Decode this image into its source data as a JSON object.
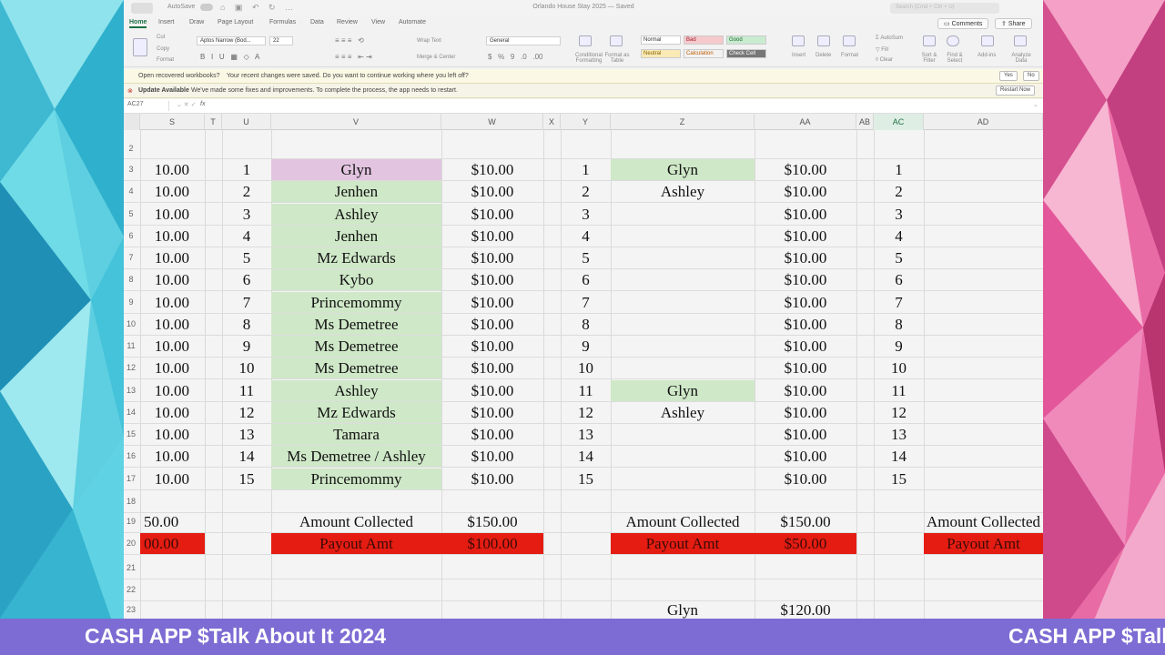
{
  "titlebar": {
    "title": "Orlando House Stay 2025 — Saved",
    "autosave": "AutoSave",
    "search_placeholder": "Search (Cmd + Ctrl + U)"
  },
  "tabs": [
    "Home",
    "Insert",
    "Draw",
    "Page Layout",
    "Formulas",
    "Data",
    "Review",
    "View",
    "Automate"
  ],
  "buttons": {
    "comments": "Comments",
    "share": "Share"
  },
  "ribbon": {
    "cut": "Cut",
    "copy": "Copy",
    "format": "Format",
    "font_name": "Aptos Narrow (Bod...",
    "font_size": "22",
    "wrap_text": "Wrap Text",
    "merge_center": "Merge & Center",
    "number_format": "General",
    "cond_format": "Conditional Formatting",
    "format_table": "Format as Table",
    "styles": [
      "Normal",
      "Bad",
      "Good",
      "Neutral",
      "Calculation",
      "Check Cell"
    ],
    "insert": "Insert",
    "delete": "Delete",
    "format_cells": "Format",
    "autosum": "AutoSum",
    "fill": "Fill",
    "clear": "Clear",
    "sort_filter": "Sort & Filter",
    "find_select": "Find & Select",
    "addins": "Add-ins",
    "analyze": "Analyze Data"
  },
  "messages": {
    "recovered": {
      "title": "Open recovered workbooks?",
      "body": "Your recent changes were saved. Do you want to continue working where you left off?",
      "yes": "Yes",
      "no": "No"
    },
    "update": {
      "title": "Update Available",
      "body": "We've made some fixes and improvements. To complete the process, the app needs to restart.",
      "restart": "Restart Now"
    }
  },
  "formula_bar": {
    "name_box": "AC27",
    "fx": "fx"
  },
  "columns": [
    "S",
    "T",
    "U",
    "V",
    "W",
    "X",
    "Y",
    "Z",
    "AA",
    "AB",
    "AC",
    "AD"
  ],
  "rows": [
    {
      "n": "2"
    },
    {
      "n": "3",
      "s": "10.00",
      "u": "1",
      "v": "Glyn",
      "w": "$10.00",
      "y": "1",
      "z": "Glyn",
      "aa": "$10.00",
      "ac": "1"
    },
    {
      "n": "4",
      "s": "10.00",
      "u": "2",
      "v": "Jenhen",
      "w": "$10.00",
      "y": "2",
      "z": "Ashley",
      "aa": "$10.00",
      "ac": "2"
    },
    {
      "n": "5",
      "s": "10.00",
      "u": "3",
      "v": "Ashley",
      "w": "$10.00",
      "y": "3",
      "aa": "$10.00",
      "ac": "3"
    },
    {
      "n": "6",
      "s": "10.00",
      "u": "4",
      "v": "Jenhen",
      "w": "$10.00",
      "y": "4",
      "aa": "$10.00",
      "ac": "4"
    },
    {
      "n": "7",
      "s": "10.00",
      "u": "5",
      "v": "Mz Edwards",
      "w": "$10.00",
      "y": "5",
      "aa": "$10.00",
      "ac": "5"
    },
    {
      "n": "8",
      "s": "10.00",
      "u": "6",
      "v": "Kybo",
      "w": "$10.00",
      "y": "6",
      "aa": "$10.00",
      "ac": "6"
    },
    {
      "n": "9",
      "s": "10.00",
      "u": "7",
      "v": "Princemommy",
      "w": "$10.00",
      "y": "7",
      "aa": "$10.00",
      "ac": "7"
    },
    {
      "n": "10",
      "s": "10.00",
      "u": "8",
      "v": "Ms Demetree",
      "w": "$10.00",
      "y": "8",
      "aa": "$10.00",
      "ac": "8"
    },
    {
      "n": "11",
      "s": "10.00",
      "u": "9",
      "v": "Ms Demetree",
      "w": "$10.00",
      "y": "9",
      "aa": "$10.00",
      "ac": "9"
    },
    {
      "n": "12",
      "s": "10.00",
      "u": "10",
      "v": "Ms Demetree",
      "w": "$10.00",
      "y": "10",
      "aa": "$10.00",
      "ac": "10"
    },
    {
      "n": "13",
      "s": "10.00",
      "u": "11",
      "v": "Ashley",
      "w": "$10.00",
      "y": "11",
      "z": "Glyn",
      "aa": "$10.00",
      "ac": "11"
    },
    {
      "n": "14",
      "s": "10.00",
      "u": "12",
      "v": "Mz Edwards",
      "w": "$10.00",
      "y": "12",
      "z": "Ashley",
      "aa": "$10.00",
      "ac": "12"
    },
    {
      "n": "15",
      "s": "10.00",
      "u": "13",
      "v": "Tamara",
      "w": "$10.00",
      "y": "13",
      "aa": "$10.00",
      "ac": "13"
    },
    {
      "n": "16",
      "s": "10.00",
      "u": "14",
      "v": "Ms Demetree / Ashley",
      "w": "$10.00",
      "y": "14",
      "aa": "$10.00",
      "ac": "14"
    },
    {
      "n": "17",
      "s": "10.00",
      "u": "15",
      "v": "Princemommy",
      "w": "$10.00",
      "y": "15",
      "aa": "$10.00",
      "ac": "15"
    },
    {
      "n": "18"
    },
    {
      "n": "19",
      "s": "50.00",
      "v": "Amount Collected",
      "w": "$150.00",
      "z": "Amount Collected",
      "aa": "$150.00",
      "ad": "Amount Collected"
    },
    {
      "n": "20",
      "s": "00.00",
      "v": "Payout Amt",
      "w": "$100.00",
      "z": "Payout Amt",
      "aa": "$50.00",
      "ad": "Payout Amt"
    },
    {
      "n": "21"
    },
    {
      "n": "22"
    },
    {
      "n": "23",
      "z": "Glyn",
      "aa": "$120.00"
    }
  ],
  "banner": {
    "text": "CASH APP $Talk About It 2024"
  },
  "colors": {
    "green_fill": "#cfe8c8",
    "pink_fill": "#e2c4e0",
    "red_fill": "#e51c12",
    "banner": "#7d6cd3",
    "excel_green": "#1e7145"
  }
}
